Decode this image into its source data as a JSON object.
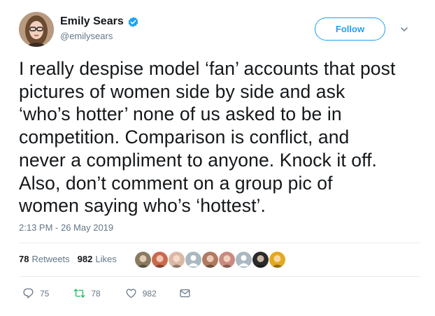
{
  "author": {
    "display_name": "Emily Sears",
    "handle": "@emilysears",
    "verified": true,
    "avatar_icon": "profile-photo"
  },
  "follow_button": {
    "label": "Follow"
  },
  "menu_icon": "chevron-down-icon",
  "tweet": {
    "lines": [
      "I really despise model ‘fan’ accounts that post",
      "pictures of women side by side and ask",
      "‘who’s hotter’ none of us asked to be in",
      "competition. Comparison is conflict, and",
      "never a compliment to anyone. Knock it off.",
      "Also, don’t comment on a group pic of",
      "women saying who’s ‘hottest’."
    ],
    "timestamp": "2:13 PM - 26 May 2019"
  },
  "stats": {
    "retweets_count": "78",
    "retweets_label": "Retweets",
    "likes_count": "982",
    "likes_label": "Likes"
  },
  "likers": [
    {
      "color": "#8a7a62",
      "kind": "photo"
    },
    {
      "color": "#c96a4d",
      "kind": "photo"
    },
    {
      "color": "#d9b9a6",
      "kind": "photo"
    },
    {
      "color": "#aab8c2",
      "kind": "default"
    },
    {
      "color": "#b07a5e",
      "kind": "photo"
    },
    {
      "color": "#c98a80",
      "kind": "photo"
    },
    {
      "color": "#aab8c2",
      "kind": "default"
    },
    {
      "color": "#2b2b2b",
      "kind": "photo"
    },
    {
      "color": "#e2a91f",
      "kind": "photo"
    }
  ],
  "actions": {
    "reply_count": "75",
    "retweet_count": "78",
    "like_count": "982"
  },
  "colors": {
    "accent": "#1da1f2",
    "muted": "#657786",
    "text": "#14171a",
    "retweet_icon": "#17bf63"
  }
}
